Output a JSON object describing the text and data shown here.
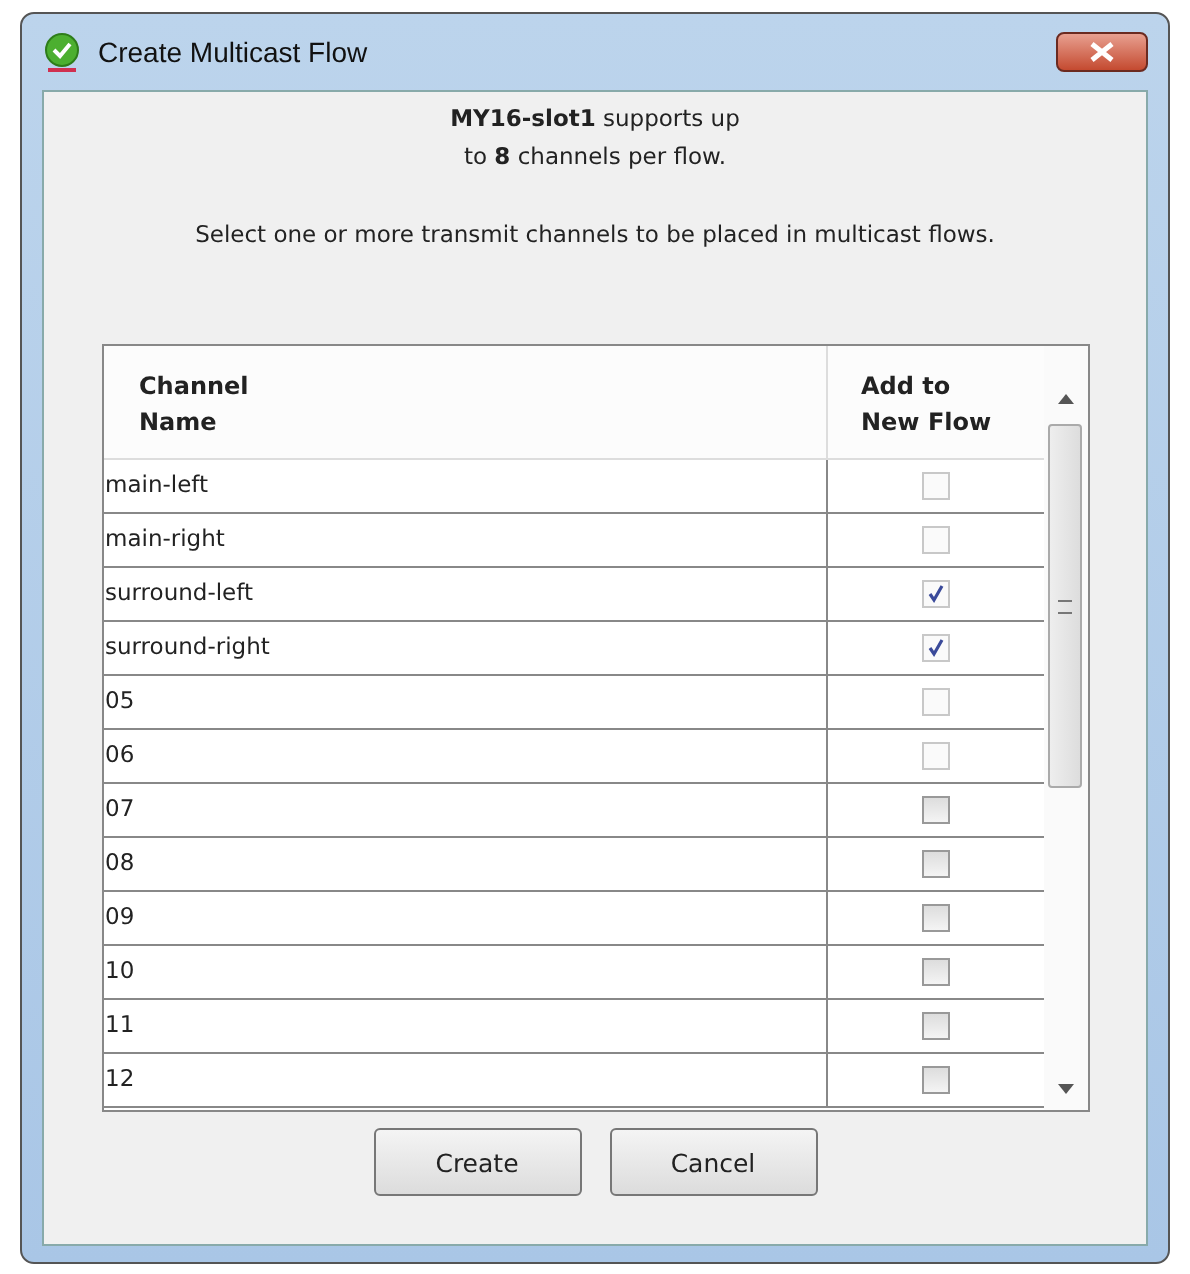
{
  "window": {
    "title": "Create Multicast Flow"
  },
  "info": "**MY16-slot1** supports up\nto **8** channels per flow.",
  "instruction": "Select one or more transmit channels to be placed in multicast flows.",
  "table": {
    "columns": [
      "Channel\nName",
      "Add to\nNew Flow"
    ],
    "rows": [
      {
        "name": "main-left",
        "checked": false,
        "disabled": true
      },
      {
        "name": "main-right",
        "checked": false,
        "disabled": true
      },
      {
        "name": "surround-left",
        "checked": true,
        "disabled": true
      },
      {
        "name": "surround-right",
        "checked": true,
        "disabled": true
      },
      {
        "name": "05",
        "checked": false,
        "disabled": true
      },
      {
        "name": "06",
        "checked": false,
        "disabled": true
      },
      {
        "name": "07",
        "checked": false,
        "disabled": false
      },
      {
        "name": "08",
        "checked": false,
        "disabled": false
      },
      {
        "name": "09",
        "checked": false,
        "disabled": false
      },
      {
        "name": "10",
        "checked": false,
        "disabled": false
      },
      {
        "name": "11",
        "checked": false,
        "disabled": false
      },
      {
        "name": "12",
        "checked": false,
        "disabled": false
      }
    ]
  },
  "buttons": [
    "Create",
    "Cancel"
  ]
}
